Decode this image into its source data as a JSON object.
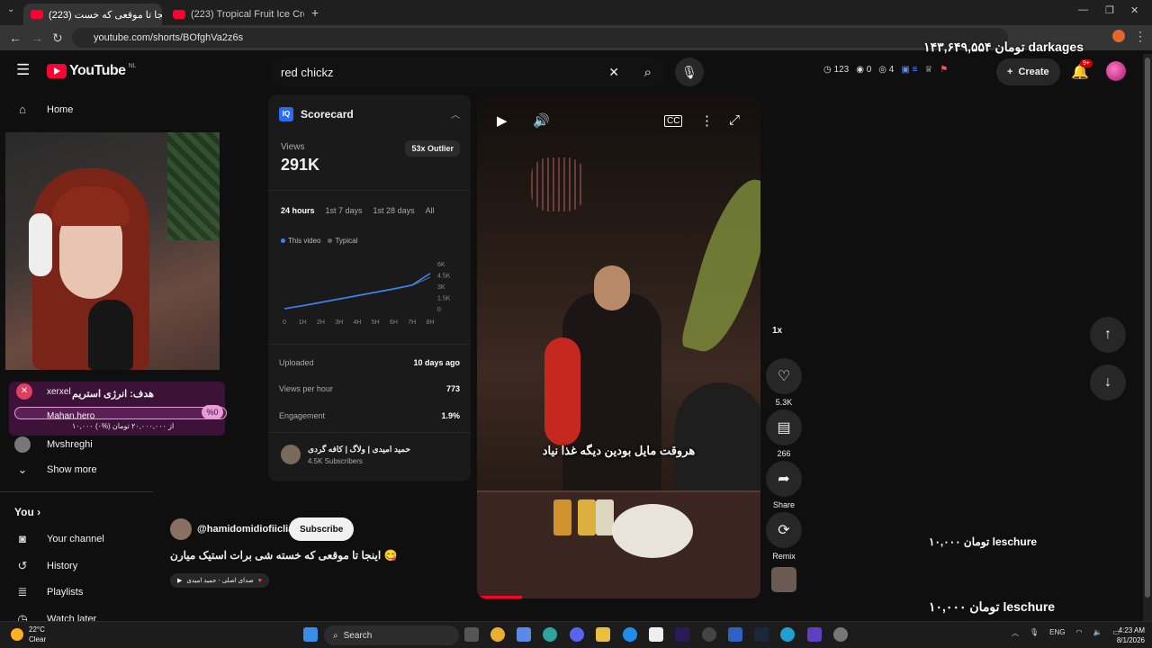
{
  "browser": {
    "tabs": [
      {
        "title": "اینجا تا موقعی که خست (223)",
        "active": true
      },
      {
        "title": "(223) Tropical Fruit Ice Cream M",
        "active": false
      }
    ],
    "new_tab": "+",
    "url": "youtube.com/shorts/BOfghVa2z6s",
    "overlay_top": "۱۴۳,۶۴۹,۵۵۴ تومان darkages"
  },
  "header": {
    "logo_text": "YouTube",
    "country_code": "NL",
    "search_value": "red chickz",
    "ext_stats": [
      "123",
      "0",
      "4"
    ],
    "create_label": "Create",
    "notif_badge": "9+"
  },
  "sidebar": {
    "home": "Home",
    "sub_item": "Mvshreghi",
    "show_more": "Show more",
    "you_heading": "You",
    "you_items": [
      "Your channel",
      "History",
      "Playlists",
      "Watch later"
    ]
  },
  "goal_overlay": {
    "user1": "xerxel",
    "title": "هدف: انرژی استریم",
    "user2": "Mahan.hero",
    "percent": "%0",
    "subtext": "۱۰,۰۰۰ از ۲۰,۰۰۰,۰۰۰ تومان (%۰)"
  },
  "scorecard": {
    "title": "Scorecard",
    "views_label": "Views",
    "views_value": "291K",
    "outlier_badge": "53x Outlier",
    "ranges": [
      "24 hours",
      "1st 7 days",
      "1st 28 days",
      "All"
    ],
    "active_range": 0,
    "legend": [
      "This video",
      "Typical"
    ],
    "uploaded_label": "Uploaded",
    "uploaded_value": "10 days ago",
    "vph_label": "Views per hour",
    "vph_value": "773",
    "engagement_label": "Engagement",
    "engagement_value": "1.9%",
    "channel_name": "حمید امیدی | ولاگ | کافه گردی",
    "channel_subs": "4.5K Subscribers"
  },
  "chart_data": {
    "type": "line",
    "x": [
      "0",
      "1H",
      "2H",
      "3H",
      "4H",
      "5H",
      "6H",
      "7H",
      "8H"
    ],
    "y_ticks": [
      "6K",
      "4.5K",
      "3K",
      "1.5K",
      "0"
    ],
    "ylim": [
      0,
      6000
    ],
    "series": [
      {
        "name": "This video",
        "color": "#3b82f6",
        "values": [
          0,
          400,
          850,
          1300,
          1750,
          2200,
          2650,
          3150,
          4700
        ]
      },
      {
        "name": "Typical",
        "color": "#666666",
        "values": [
          0,
          380,
          800,
          1250,
          1700,
          2150,
          2600,
          3100,
          4200
        ]
      }
    ]
  },
  "owner": {
    "handle": "@hamidomidiofiicliall",
    "subscribe_label": "Subscribe",
    "short_title": "اینجا تا موقعی که خسته شی برات استیک میارن 😋",
    "music": "صدای اصلی - حمید امیدی"
  },
  "video": {
    "subtitle": "هروقت مایل بودین دیگه غذا نیاد",
    "progress": 0.16
  },
  "rail": {
    "speed": "1x",
    "likes": "5.3K",
    "comments": "266",
    "share": "Share",
    "remix": "Remix"
  },
  "donations": [
    "۱۰,۰۰۰ تومان leschure",
    "۱۰,۰۰۰ تومان leschure"
  ],
  "taskbar": {
    "temp": "22°C",
    "condition": "Clear",
    "search": "Search",
    "lang": "ENG",
    "time": "4:23 AM",
    "date": "8/1/2026"
  },
  "colors": {
    "accent_red": "#ff0033",
    "scorecard_blue": "#2c6cf0",
    "goal_bg": "#3c1238"
  }
}
